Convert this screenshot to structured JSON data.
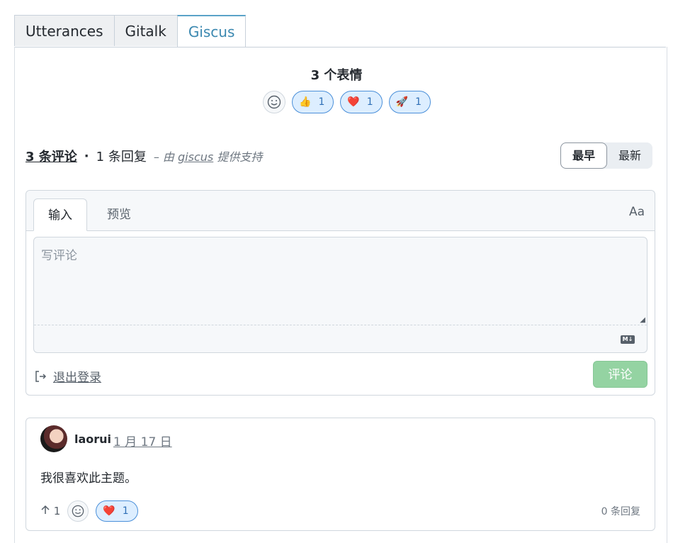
{
  "tabs": [
    "Utterances",
    "Gitalk",
    "Giscus"
  ],
  "reactions": {
    "title": "3 个表情",
    "items": [
      {
        "emoji": "👍",
        "icon": "thumbs-up",
        "count": "1"
      },
      {
        "emoji": "❤️",
        "icon": "heart",
        "count": "1"
      },
      {
        "emoji": "🚀",
        "icon": "rocket",
        "count": "1"
      }
    ]
  },
  "summary": {
    "comments": "3 条评论",
    "separator": "·",
    "replies": "1 条回复",
    "powered_prefix": "– 由",
    "powered_link": "giscus",
    "powered_suffix": "提供支持"
  },
  "sort": {
    "oldest": "最早",
    "newest": "最新"
  },
  "editor": {
    "tab_write": "输入",
    "tab_preview": "预览",
    "format_toggle": "Aa",
    "placeholder": "写评论",
    "markdown_badge": "M↓",
    "logout": "退出登录",
    "submit": "评论"
  },
  "comment": {
    "author": "laorui",
    "date": "1 月 17 日",
    "body": "我很喜欢此主题。",
    "upvotes": "1",
    "reaction_emoji": "❤️",
    "reaction_count": "1",
    "reply_count": "0 条回复"
  },
  "colors": {
    "active_tab": "#3b88b0",
    "reaction_border": "#4a8fd9",
    "reaction_bg": "#ddeeff",
    "submit_bg": "#94d3a2"
  }
}
